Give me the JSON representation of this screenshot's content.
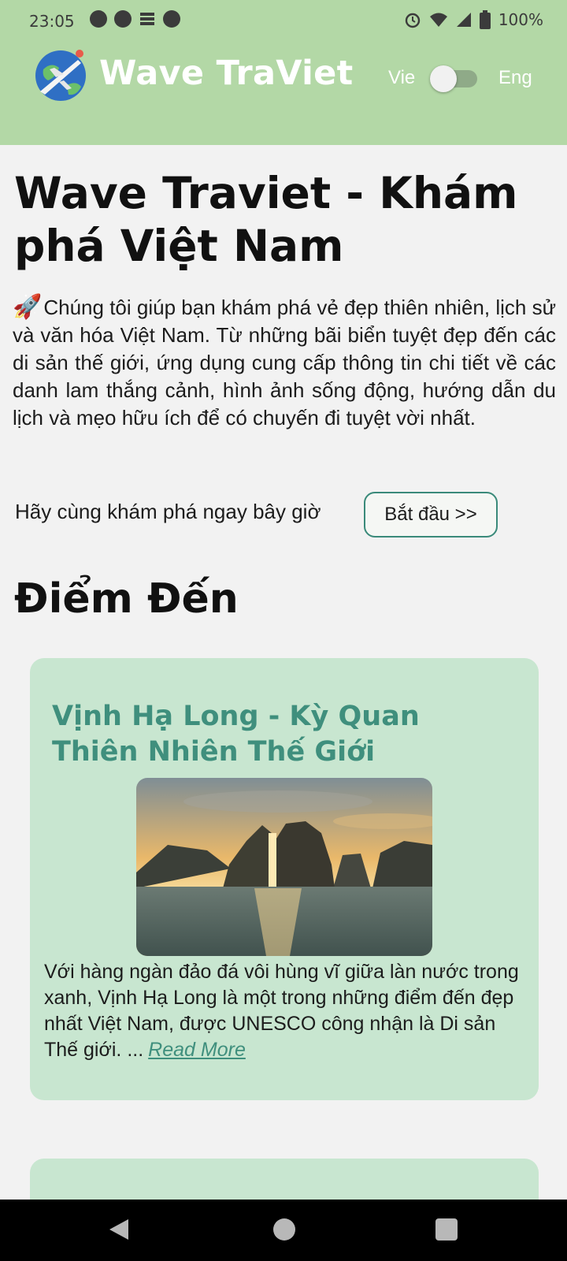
{
  "status_bar": {
    "time": "23:05",
    "battery": "100%",
    "icons_left": [
      "app-notification-icon",
      "app-notification-icon",
      "stack-icon",
      "app-notification-icon"
    ],
    "icons_right": [
      "alarm-icon",
      "wifi-icon",
      "signal-icon",
      "battery-icon"
    ]
  },
  "header": {
    "app_title": "Wave TraViet",
    "lang_left": "Vie",
    "lang_right": "Eng",
    "toggle_on": false,
    "background": "#b3d8a6"
  },
  "main": {
    "title": "Wave Traviet - Khám phá Việt Nam",
    "intro_icon": "🚀",
    "intro": "Chúng tôi giúp bạn khám phá vẻ đẹp thiên nhiên, lịch sử và văn hóa Việt Nam. Từ những bãi biển tuyệt đẹp đến các di sản thế giới, ứng dụng cung cấp thông tin chi tiết về các danh lam thắng cảnh, hình ảnh sống động, hướng dẫn du lịch và mẹo hữu ích để có chuyến đi tuyệt vời nhất.",
    "cta_text": "Hãy cùng khám phá ngay bây giờ",
    "cta_button": "Bắt đầu >>"
  },
  "destinations": {
    "section_title": "Điểm Đến",
    "cards": [
      {
        "title": "Vịnh Hạ Long - Kỳ Quan Thiên Nhiên Thế Giới",
        "description": "Với hàng ngàn đảo đá vôi hùng vĩ giữa làn nước trong xanh, Vịnh Hạ Long là một trong những điểm đến đẹp nhất Việt Nam, được UNESCO công nhận là Di sản Thế giới. ...",
        "read_more": "Read More",
        "background": "#c8e6d0",
        "title_color": "#3f8f7d"
      }
    ]
  },
  "colors": {
    "accent": "#3f8f7d",
    "page_bg": "#f2f2f2"
  }
}
